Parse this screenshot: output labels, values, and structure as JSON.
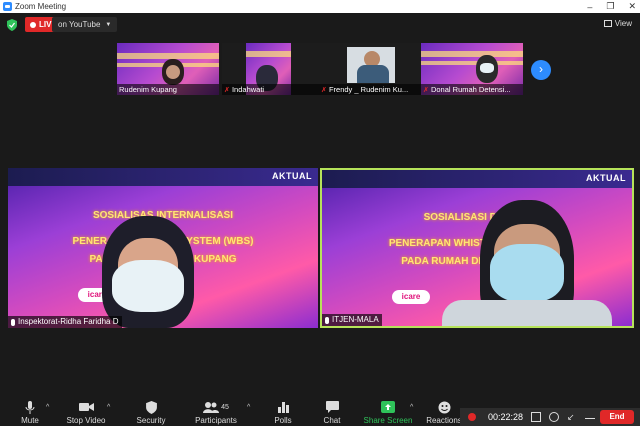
{
  "window": {
    "title": "Zoom Meeting"
  },
  "topbar": {
    "live_label": "LIVE",
    "stream_label": "on YouTube",
    "view_label": "View"
  },
  "strip": [
    {
      "name": "Rudenim Kupang"
    },
    {
      "name": "Indahwati"
    },
    {
      "name": "Frendy _ Rudenim Ku..."
    },
    {
      "name": "Donal Rumah Detensi..."
    }
  ],
  "tiles": [
    {
      "name": "Inspektorat-Ridha Faridha D",
      "brand": "AKTUAL",
      "line1": "SOSIALISAS    INTERNALISASI",
      "line2": "PENERAPAN W          WING SYSTEM (WBS)",
      "line3": "PADA RUMAH          GRASI KUPANG",
      "icare": "icare"
    },
    {
      "name": "ITJEN-MALA",
      "brand": "AKTUAL",
      "line1": "SOSIALISASI DAN       ASI",
      "line2": "PENERAPAN WHISTLE BL          EM (WBS)",
      "line3": "PADA RUMAH DETENSI          UPANG",
      "icare": "icare"
    }
  ],
  "toolbar": {
    "mute": "Mute",
    "stop_video": "Stop Video",
    "security": "Security",
    "participants": "Participants",
    "participants_count": "45",
    "polls": "Polls",
    "chat": "Chat",
    "share_screen": "Share Screen",
    "reactions": "Reactions"
  },
  "recording": {
    "time": "00:22:28",
    "end_label": "End"
  },
  "colors": {
    "accent": "#2d8cff",
    "live": "#e02828",
    "active_border": "#b6e35a",
    "share": "#2fc35a"
  }
}
